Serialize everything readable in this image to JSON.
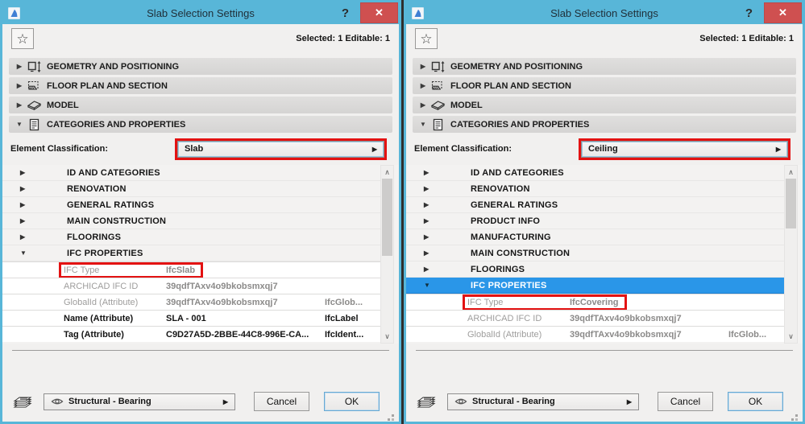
{
  "colors": {
    "titlebar_blue": "#58b6d8",
    "close_red": "#cf5050",
    "selection_blue": "#2a96e8",
    "annotation_red": "#e31212"
  },
  "icons": {
    "help": "?",
    "close": "✕",
    "star": "☆",
    "scroll_up": "∧",
    "scroll_down": "∨",
    "caret_right": "▶",
    "caret_down": "▼"
  },
  "windows": [
    {
      "title": "Slab Selection Settings",
      "status": "Selected: 1 Editable: 1",
      "sections": [
        {
          "label": "GEOMETRY AND POSITIONING",
          "icon": "geometry",
          "expanded": false
        },
        {
          "label": "FLOOR PLAN AND SECTION",
          "icon": "floorplan",
          "expanded": false
        },
        {
          "label": "MODEL",
          "icon": "model",
          "expanded": false
        },
        {
          "label": "CATEGORIES AND PROPERTIES",
          "icon": "categories",
          "expanded": true
        }
      ],
      "classification": {
        "label": "Element Classification:",
        "value": "Slab",
        "highlighted": true
      },
      "list": [
        {
          "type": "tree",
          "label": "ID AND CATEGORIES",
          "expanded": false
        },
        {
          "type": "tree",
          "label": "RENOVATION",
          "expanded": false
        },
        {
          "type": "tree",
          "label": "GENERAL RATINGS",
          "expanded": false
        },
        {
          "type": "tree",
          "label": "MAIN CONSTRUCTION",
          "expanded": false
        },
        {
          "type": "tree",
          "label": "FLOORINGS",
          "expanded": false
        },
        {
          "type": "tree",
          "label": "IFC PROPERTIES",
          "expanded": true,
          "selected": false
        },
        {
          "type": "prop",
          "label": "IFC Type",
          "value": "IfcSlab",
          "ifc": "",
          "gray": true,
          "highlighted": true
        },
        {
          "type": "prop",
          "label": "ARCHICAD IFC ID",
          "value": "39qdfTAxv4o9bkobsmxqj7",
          "ifc": "",
          "gray": true,
          "highlighted": false
        },
        {
          "type": "prop",
          "label": "GlobalId (Attribute)",
          "value": "39qdfTAxv4o9bkobsmxqj7",
          "ifc": "IfcGlob...",
          "gray": true,
          "highlighted": false
        },
        {
          "type": "prop",
          "label": "Name (Attribute)",
          "value": "SLA - 001",
          "ifc": "IfcLabel",
          "gray": false,
          "highlighted": false
        },
        {
          "type": "prop",
          "label": "Tag (Attribute)",
          "value": "C9D27A5D-2BBE-44C8-996E-CA...",
          "ifc": "IfcIdent...",
          "gray": false,
          "highlighted": false
        }
      ],
      "scrollbar_thumb": "tall",
      "footer": {
        "layer": "Structural - Bearing",
        "cancel": "Cancel",
        "ok": "OK"
      }
    },
    {
      "title": "Slab Selection Settings",
      "status": "Selected: 1 Editable: 1",
      "sections": [
        {
          "label": "GEOMETRY AND POSITIONING",
          "icon": "geometry",
          "expanded": false
        },
        {
          "label": "FLOOR PLAN AND SECTION",
          "icon": "floorplan",
          "expanded": false
        },
        {
          "label": "MODEL",
          "icon": "model",
          "expanded": false
        },
        {
          "label": "CATEGORIES AND PROPERTIES",
          "icon": "categories",
          "expanded": true
        }
      ],
      "classification": {
        "label": "Element Classification:",
        "value": "Ceiling",
        "highlighted": true
      },
      "list": [
        {
          "type": "tree",
          "label": "ID AND CATEGORIES",
          "expanded": false
        },
        {
          "type": "tree",
          "label": "RENOVATION",
          "expanded": false
        },
        {
          "type": "tree",
          "label": "GENERAL RATINGS",
          "expanded": false
        },
        {
          "type": "tree",
          "label": "PRODUCT INFO",
          "expanded": false
        },
        {
          "type": "tree",
          "label": "MANUFACTURING",
          "expanded": false
        },
        {
          "type": "tree",
          "label": "MAIN CONSTRUCTION",
          "expanded": false
        },
        {
          "type": "tree",
          "label": "FLOORINGS",
          "expanded": false
        },
        {
          "type": "tree",
          "label": "IFC PROPERTIES",
          "expanded": true,
          "selected": true
        },
        {
          "type": "prop",
          "label": "IFC Type",
          "value": "IfcCovering",
          "ifc": "",
          "gray": true,
          "highlighted": true
        },
        {
          "type": "prop",
          "label": "ARCHICAD IFC ID",
          "value": "39qdfTAxv4o9bkobsmxqj7",
          "ifc": "",
          "gray": true,
          "highlighted": false
        },
        {
          "type": "prop",
          "label": "GlobalId (Attribute)",
          "value": "39qdfTAxv4o9bkobsmxqj7",
          "ifc": "IfcGlob...",
          "gray": true,
          "highlighted": false
        }
      ],
      "scrollbar_thumb": "short",
      "footer": {
        "layer": "Structural - Bearing",
        "cancel": "Cancel",
        "ok": "OK"
      }
    }
  ]
}
